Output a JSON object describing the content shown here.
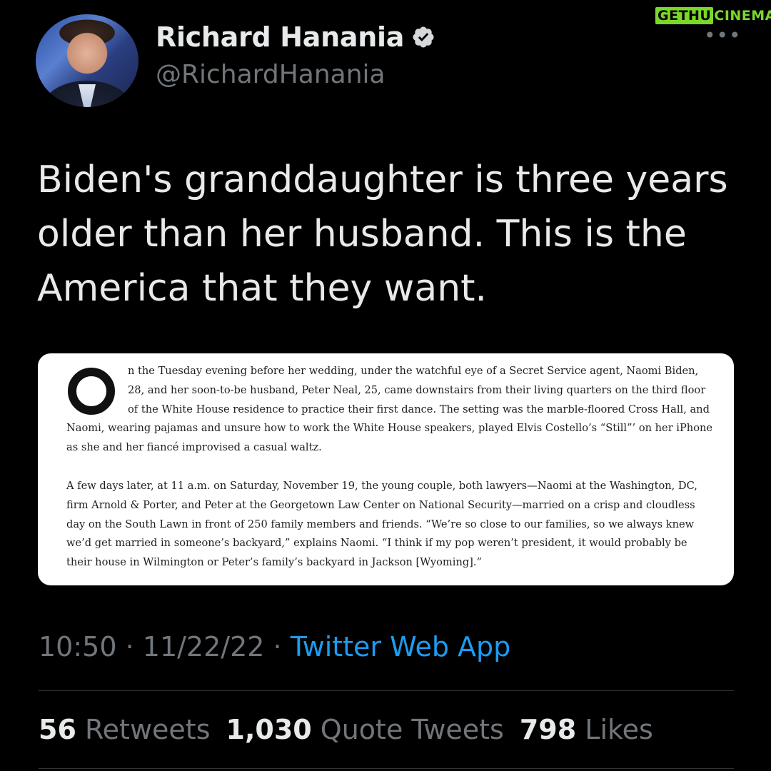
{
  "watermark": {
    "part1": "GETHU",
    "part2": "CINEMA"
  },
  "author": {
    "name": "Richard Hanania",
    "handle": "@RichardHanania",
    "verified": true
  },
  "more_icon": "more-horizontal-icon",
  "tweet": {
    "text": "Biden's granddaughter is three years older than her husband. This is the America that they want."
  },
  "media": {
    "paragraph1": "n the Tuesday evening before her wedding, under the watchful eye of a Secret Service agent, Naomi Biden, 28, and her soon-to-be husband, Peter Neal, 25, came downstairs from their living quarters on the third floor of the White House residence to practice their first dance. The setting was the marble-floored Cross Hall, and Naomi, wearing pajamas and unsure how to work the White House speakers, played Elvis Costello’s “Still”’ on her iPhone as she and her fiancé improvised a casual waltz.",
    "paragraph2": "A few days later, at 11 a.m. on Saturday, November 19, the young couple, both lawyers—Naomi at the Washington, DC, firm Arnold & Porter, and Peter at the Georgetown Law Center on National Security—married on a crisp and cloudless day on the South Lawn in front of 250 family members and friends. “We’re so close to our families, so we always knew we’d get married in someone’s backyard,” explains Naomi. “I think if my pop weren’t president, it would probably be their house in Wilmington or Peter’s family’s backyard in Jackson [Wyoming].”"
  },
  "meta": {
    "time": "10:50",
    "separator": " · ",
    "date": "11/22/22",
    "source": "Twitter Web App"
  },
  "stats": {
    "retweets_count": "56",
    "retweets_label": "Retweets",
    "quotes_count": "1,030",
    "quotes_label": "Quote Tweets",
    "likes_count": "798",
    "likes_label": "Likes"
  },
  "colors": {
    "background": "#000000",
    "text": "#e7e9ea",
    "secondary": "#71767b",
    "link": "#1d9bf0",
    "watermark": "#7bd828"
  }
}
